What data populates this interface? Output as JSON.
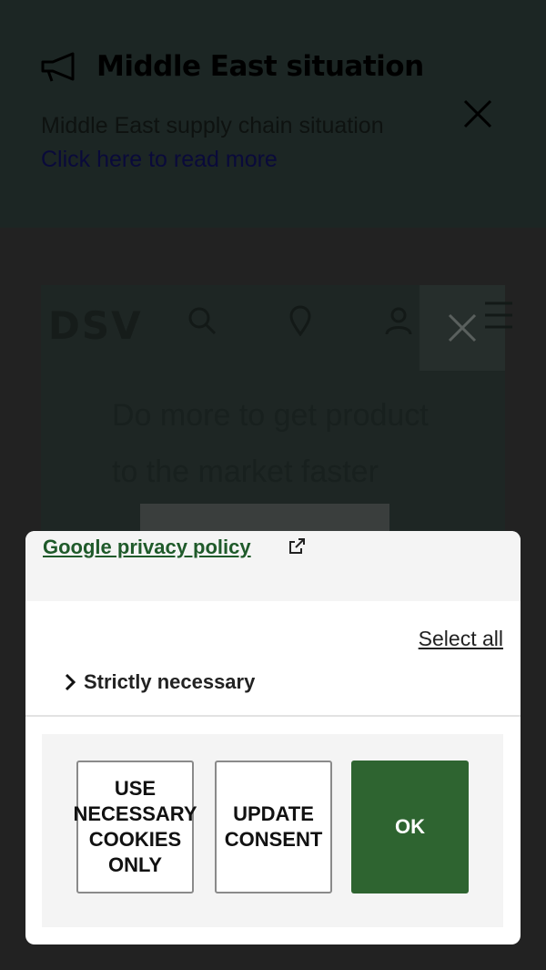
{
  "banner": {
    "title": "Middle East situation",
    "text": "Middle East supply chain situation",
    "link": "Click here to read more"
  },
  "header": {
    "logo": "DSV",
    "ghost_line_1": "Do more to get product",
    "ghost_line_2": "to the market faster"
  },
  "consent": {
    "privacy_link": "Google privacy policy ",
    "select_all": "Select all",
    "category": "Strictly necessary",
    "buttons": {
      "necessary": "USE\nNECESSARY\nCOOKIES\nONLY",
      "update": "UPDATE\nCONSENT",
      "ok": "OK"
    }
  },
  "colors": {
    "accent": "#2e6430",
    "link": "#1f5a2a",
    "overlay": "#222222"
  },
  "icons": {
    "banner": "megaphone-icon",
    "banner_close": "close-icon",
    "privacy_link": "external-link-icon",
    "category": "chevron-right-icon"
  }
}
